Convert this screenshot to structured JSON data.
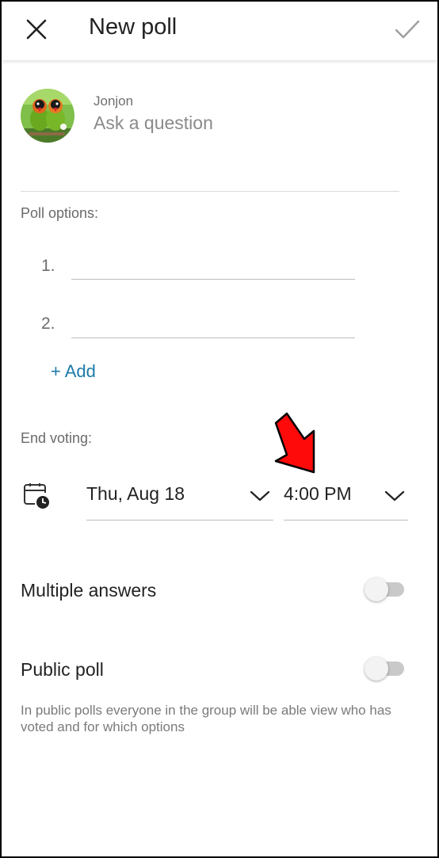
{
  "header": {
    "title": "New poll",
    "close_icon": "close-icon",
    "confirm_icon": "check-icon"
  },
  "composer": {
    "author": "Jonjon",
    "question_placeholder": "Ask a question"
  },
  "poll_options": {
    "label": "Poll options:",
    "items": [
      {
        "number": "1.",
        "value": ""
      },
      {
        "number": "2.",
        "value": ""
      }
    ],
    "add_label": "+ Add"
  },
  "end_voting": {
    "label": "End voting:",
    "date": "Thu, Aug 18",
    "time": "4:00 PM",
    "icon": "calendar-clock-icon"
  },
  "settings": {
    "multiple_answers": {
      "label": "Multiple answers",
      "enabled": false
    },
    "public_poll": {
      "label": "Public poll",
      "enabled": false
    },
    "public_help": "In public polls everyone in the group will be able view who has voted and for which options"
  },
  "colors": {
    "accent": "#1d7aa8",
    "annotation_arrow": "#ff0000"
  }
}
